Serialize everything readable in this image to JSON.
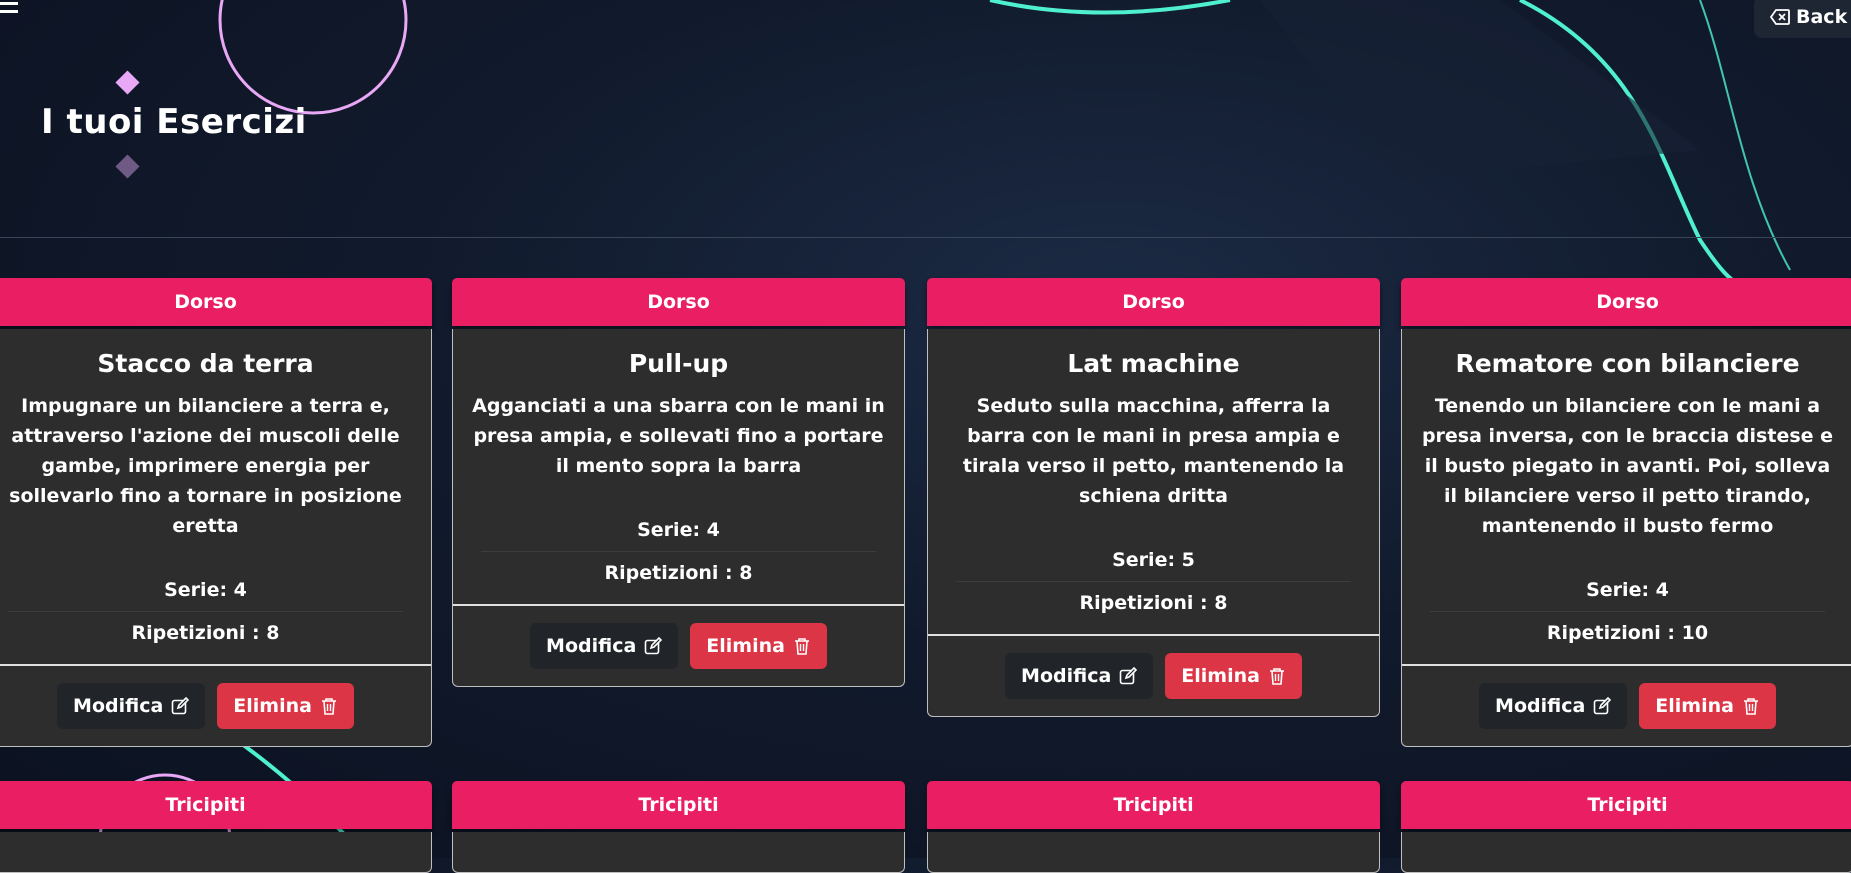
{
  "header": {
    "title": "I tuoi Esercizi",
    "back_label": "Back"
  },
  "colors": {
    "accent": "#e91e63",
    "danger": "#dc3545",
    "card_bg": "#2d2d2d",
    "neon": "#4ff0d0",
    "violet": "#e9a8f5"
  },
  "cards": [
    {
      "category": "Dorso",
      "title": "Stacco da terra",
      "description": "Impugnare un bilanciere a terra e, attraverso l'azione dei muscoli delle gambe, imprimere energia per sollevarlo fino a tornare in posizione eretta",
      "series": "Serie: 4",
      "reps": "Ripetizioni : 8",
      "edit_label": "Modifica",
      "delete_label": "Elimina"
    },
    {
      "category": "Dorso",
      "title": "Pull-up",
      "description": "Agganciati a una sbarra con le mani in presa ampia, e sollevati fino a portare il mento sopra la barra",
      "series": "Serie: 4",
      "reps": "Ripetizioni : 8",
      "edit_label": "Modifica",
      "delete_label": "Elimina"
    },
    {
      "category": "Dorso",
      "title": "Lat machine",
      "description": "Seduto sulla macchina, afferra la barra con le mani in presa ampia e tirala verso il petto, mantenendo la schiena dritta",
      "series": "Serie: 5",
      "reps": "Ripetizioni : 8",
      "edit_label": "Modifica",
      "delete_label": "Elimina"
    },
    {
      "category": "Dorso",
      "title": "Rematore con bilanciere",
      "description": "Tenendo un bilanciere con le mani a presa inversa, con le braccia distese e il busto piegato in avanti. Poi, solleva il bilanciere verso il petto tirando, mantenendo il busto fermo",
      "series": "Serie: 4",
      "reps": "Ripetizioni : 10",
      "edit_label": "Modifica",
      "delete_label": "Elimina"
    }
  ],
  "next_row": [
    "Tricipiti",
    "Tricipiti",
    "Tricipiti",
    "Tricipiti"
  ]
}
